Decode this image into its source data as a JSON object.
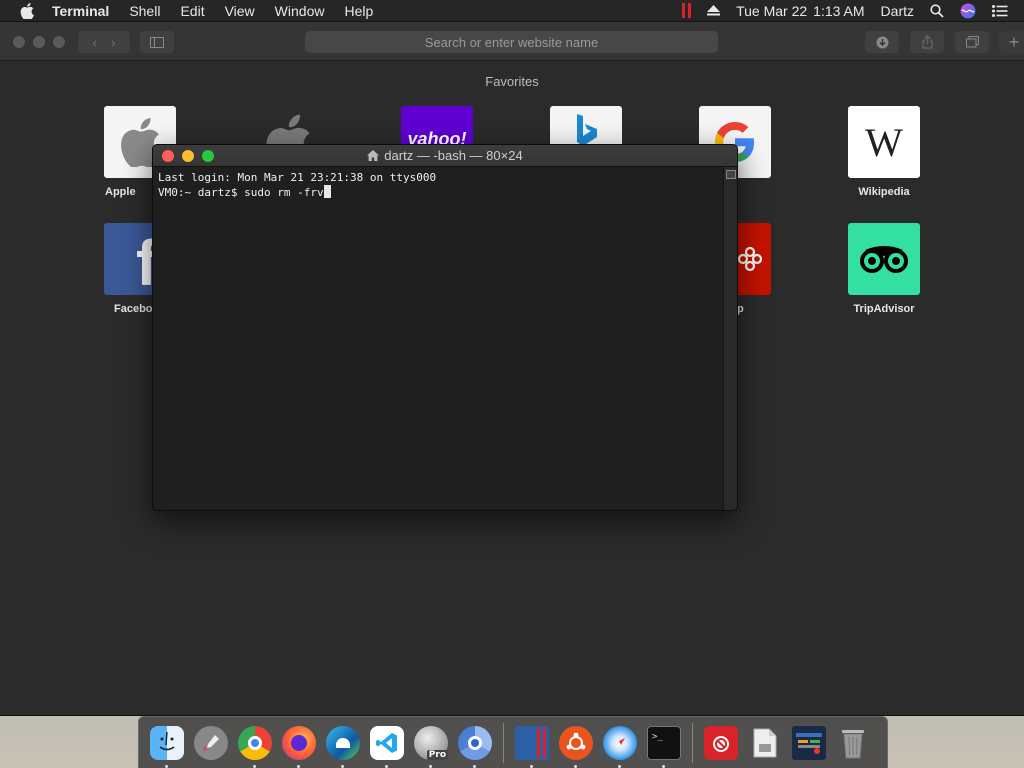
{
  "menubar": {
    "apple_icon": "apple-logo-icon",
    "app_name": "Terminal",
    "menus": [
      "Shell",
      "Edit",
      "View",
      "Window",
      "Help"
    ],
    "date": "Tue Mar 22",
    "time": "1:13 AM",
    "user": "Dartz",
    "status_icons": [
      "parallels-icon",
      "eject-icon",
      "search-icon",
      "siri-icon",
      "list-icon"
    ]
  },
  "safari": {
    "address_placeholder": "Search or enter website name",
    "favorites_title": "Favorites",
    "favorites": [
      {
        "label": "Apple",
        "icon": "apple-logo-icon"
      },
      {
        "label": "",
        "icon": "apple-logo-icon"
      },
      {
        "label": "",
        "icon": "yahoo-icon",
        "text": "yahoo!"
      },
      {
        "label": "",
        "icon": "bing-icon"
      },
      {
        "label": "gle",
        "icon": "google-icon"
      },
      {
        "label": "Wikipedia",
        "icon": "wikipedia-icon",
        "text": "W"
      },
      {
        "label": "Facebo",
        "icon": "facebook-icon",
        "text": "f"
      },
      {
        "label": "p",
        "icon": "yelp-icon"
      },
      {
        "label": "TripAdvisor",
        "icon": "tripadvisor-icon"
      }
    ]
  },
  "terminal": {
    "title": "dartz — -bash — 80×24",
    "lines": [
      "Last login: Mon Mar 21 23:21:38 on ttys000",
      "VM0:~ dartz$ sudo rm -frv"
    ]
  },
  "dock": {
    "items": [
      {
        "name": "finder",
        "running": true
      },
      {
        "name": "launchpad",
        "running": false
      },
      {
        "name": "chrome",
        "running": true
      },
      {
        "name": "firefox",
        "running": true
      },
      {
        "name": "edge",
        "running": true
      },
      {
        "name": "vscode",
        "running": true
      },
      {
        "name": "pro",
        "running": true,
        "text": "Pro"
      },
      {
        "name": "chromium",
        "running": true
      },
      {
        "name": "parallels",
        "running": true
      },
      {
        "name": "ubuntu",
        "running": true
      },
      {
        "name": "safari",
        "running": true
      },
      {
        "name": "terminal",
        "running": true
      },
      {
        "name": "parallels-toolbox",
        "running": false
      },
      {
        "name": "document",
        "running": false
      },
      {
        "name": "app-window",
        "running": false
      },
      {
        "name": "trash",
        "running": false
      }
    ]
  },
  "colors": {
    "terminal_bg": "#1f1f1f",
    "safari_bg": "#2b2b2b",
    "close": "#ff5f57",
    "minimize": "#febc2e",
    "maximize": "#28c840",
    "tripadvisor": "#34e0a1",
    "yahoo": "#6001d2"
  }
}
